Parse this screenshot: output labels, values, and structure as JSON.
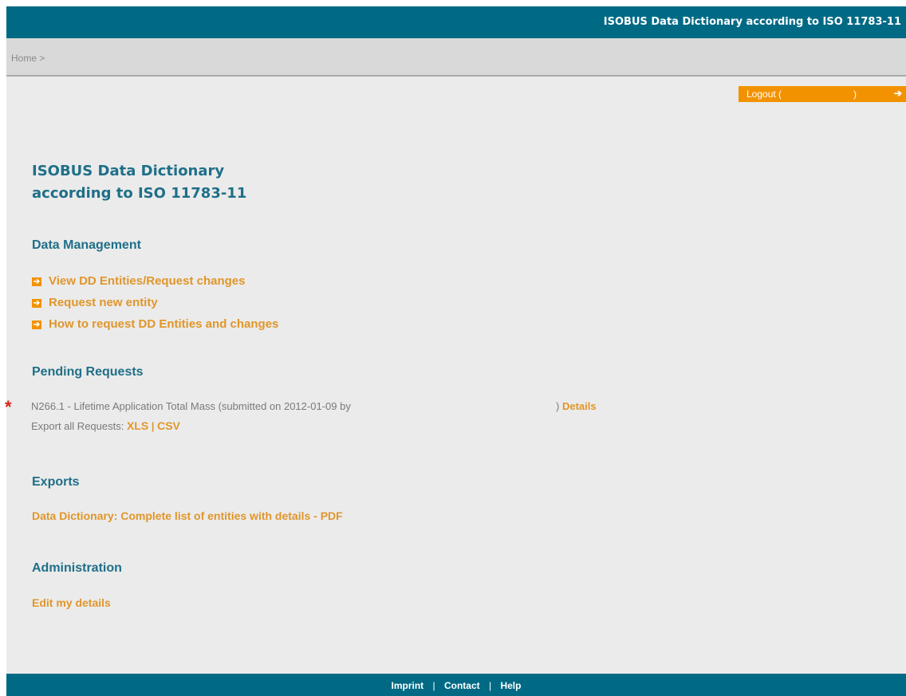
{
  "header": {
    "title": "ISOBUS Data Dictionary according to ISO 11783-11"
  },
  "breadcrumb": {
    "text": "Home >"
  },
  "logout": {
    "label": "Logout (",
    "close_paren": ")",
    "icon": "arrow-right-icon"
  },
  "page": {
    "title_line1": "ISOBUS Data Dictionary",
    "title_line2": "according to ISO 11783-11"
  },
  "data_management": {
    "heading": "Data Management",
    "links": [
      {
        "label": "View DD Entities/Request changes",
        "icon": "arrow-right-icon"
      },
      {
        "label": "Request new entity",
        "icon": "arrow-right-icon"
      },
      {
        "label": "How to request DD Entities and changes",
        "icon": "arrow-right-icon"
      }
    ]
  },
  "pending": {
    "heading": "Pending Requests",
    "marker": "*",
    "request_text": "N266.1 - Lifetime Application Total Mass (submitted on 2012-01-09 by",
    "request_close": ")",
    "details_label": "Details",
    "export_label": "Export all Requests:",
    "xls_label": "XLS",
    "separator": "|",
    "csv_label": "CSV"
  },
  "exports": {
    "heading": "Exports",
    "pdf_link": "Data Dictionary: Complete list of entities with details - PDF"
  },
  "administration": {
    "heading": "Administration",
    "edit_link": "Edit my details"
  },
  "footer": {
    "imprint": "Imprint",
    "contact": "Contact",
    "help": "Help",
    "separator": "|"
  },
  "colors": {
    "primary": "#006a85",
    "accent": "#f39200",
    "link": "#e0962a",
    "heading": "#1f6f88",
    "marker": "#d9261c"
  }
}
